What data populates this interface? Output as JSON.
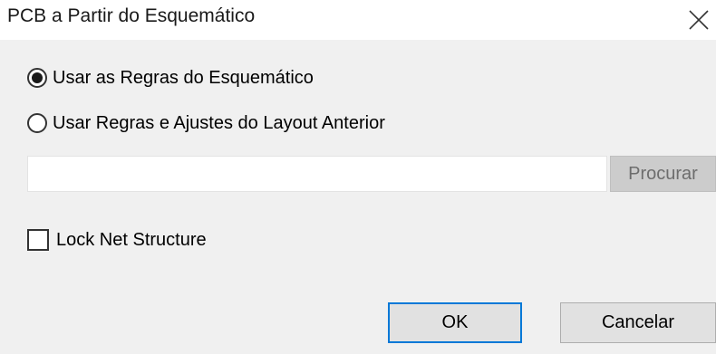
{
  "window": {
    "title": "PCB a Partir do Esquemático",
    "close_icon": "close-icon"
  },
  "options": [
    {
      "label": "Usar as Regras do Esquemático",
      "selected": true
    },
    {
      "label": "Usar Regras e Ajustes do Layout Anterior",
      "selected": false
    }
  ],
  "layout_file": {
    "value": "",
    "placeholder": "",
    "browse_label": "Procurar",
    "browse_enabled": false
  },
  "lock_net": {
    "label": "Lock Net Structure",
    "checked": false
  },
  "buttons": {
    "ok_label": "OK",
    "cancel_label": "Cancelar"
  },
  "colors": {
    "content_bg": "#f0f0f0",
    "focus_border": "#0078d7",
    "disabled_button_bg": "#cccccc",
    "disabled_text": "#6d6d6d"
  }
}
